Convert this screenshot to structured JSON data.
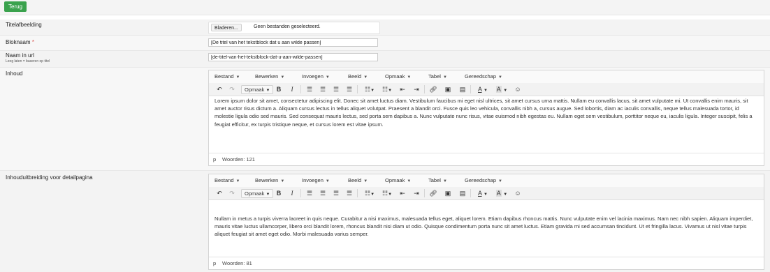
{
  "topbar": {
    "back_label": "Terug"
  },
  "fields": {
    "titelafbeelding": {
      "label": "Titelafbeelding",
      "browse_label": "Bladeren...",
      "file_status": "Geen bestanden geselecteerd."
    },
    "bloknaam": {
      "label": "Bloknaam",
      "required_mark": "*",
      "value": "[De titel van het tekstblock dat u aan wilde passen]"
    },
    "naam_in_url": {
      "label": "Naam in url",
      "hint": "Leeg laten = baseren op titel",
      "value": "[de-titel-van-het-tekstblock-dat-u-aan-wilde-passen]"
    },
    "inhoud": {
      "label": "Inhoud"
    },
    "inhoud_uitbreiding": {
      "label": "Inhouduitbreiding voor detailpagina"
    }
  },
  "editor_menu": [
    "Bestand",
    "Bewerken",
    "Invoegen",
    "Beeld",
    "Opmaak",
    "Tabel",
    "Gereedschap"
  ],
  "editor_toolbar": {
    "format_label": "Opmaak",
    "undo_icon": "undo-icon",
    "redo_icon": "redo-icon",
    "bold": "B",
    "italic": "I",
    "text_color": "A",
    "bg_color": "A"
  },
  "editor1": {
    "content": "Lorem ipsum dolor sit amet, consectetur adipiscing elit. Donec sit amet luctus diam. Vestibulum faucibus mi eget nisl ultrices, sit amet cursus urna mattis. Nullam eu convallis lacus, sit amet vulputate mi. Ut convallis enim mauris, sit amet auctor risus dictum a. Aliquam cursus lectus in tellus aliquet volutpat. Praesent a blandit orci. Fusce quis leo vehicula, convallis nibh a, cursus augue. Sed lobortis, diam ac iaculis convallis, neque tellus malesuada tortor, id molestie ligula odio sed mauris. Sed consequat mauris lectus, sed porta sem dapibus a. Nunc vulputate nunc risus, vitae euismod nibh egestas eu. Nullam eget sem vestibulum, porttitor neque eu, iaculis ligula. Integer suscipit, felis a feugiat efficitur, ex turpis tristique neque, et cursus lorem est vitae ipsum.",
    "status_path": "p",
    "word_count": "Woorden: 121"
  },
  "editor2": {
    "content": "Nullam in metus a turpis viverra laoreet in quis neque. Curabitur a nisi maximus, malesuada tellus eget, aliquet lorem. Etiam dapibus rhoncus mattis. Nunc vulputate enim vel lacinia maximus. Nam nec nibh sapien. Aliquam imperdiet, mauris vitae luctus ullamcorper, libero orci blandit lorem, rhoncus blandit nisi diam ut odio. Quisque condimentum porta nunc sit amet luctus. Etiam gravida mi sed accumsan tincidunt. Ut et fringilla lacus. Vivamus ut nisl vitae turpis aliquet feugiat sit amet eget odio. Morbi malesuada varius semper.",
    "status_path": "p",
    "word_count": "Woorden: 81"
  },
  "colors": {
    "back_button": "#3aa24d",
    "required": "#d9534f",
    "row_bg": "#f3f3f3"
  }
}
